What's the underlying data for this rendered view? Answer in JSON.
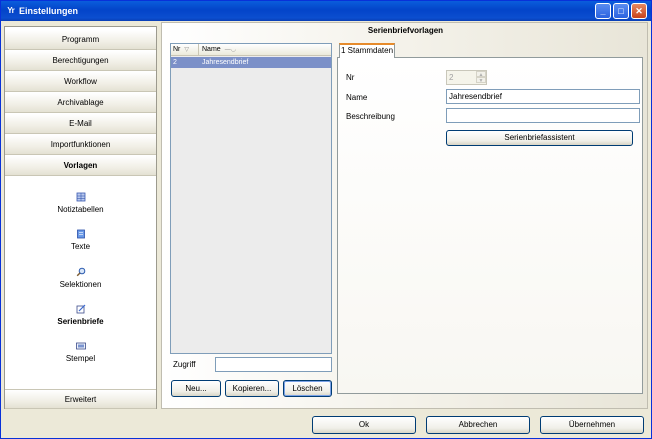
{
  "window": {
    "title": "Einstellungen",
    "icon": "app-logo-icon",
    "controls": {
      "minimize": "_",
      "maximize": "□",
      "close": "✕"
    }
  },
  "sidebar": {
    "items": [
      {
        "label": "Programm"
      },
      {
        "label": "Berechtigungen"
      },
      {
        "label": "Workflow"
      },
      {
        "label": "Archivablage"
      },
      {
        "label": "E-Mail"
      },
      {
        "label": "Importfunktionen"
      },
      {
        "label": "Vorlagen",
        "active": true
      }
    ],
    "sub_items": [
      {
        "label": "Notiztabellen",
        "icon": "table-icon"
      },
      {
        "label": "Texte",
        "icon": "text-icon"
      },
      {
        "label": "Selektionen",
        "icon": "magnifier-icon"
      },
      {
        "label": "Serienbriefe",
        "icon": "letter-icon",
        "active": true
      },
      {
        "label": "Stempel",
        "icon": "stamp-icon"
      }
    ],
    "footer": {
      "label": "Erweitert"
    }
  },
  "panel": {
    "title": "Serienbriefvorlagen",
    "list": {
      "columns": [
        "Nr",
        "Name"
      ],
      "rows": [
        {
          "nr": "2",
          "name": "Jahresendbrief"
        }
      ]
    },
    "zugriff": {
      "label": "Zugriff",
      "value": ""
    },
    "buttons": {
      "new": "Neu...",
      "copy": "Kopieren...",
      "delete": "Löschen"
    },
    "tab": {
      "label": "1 Stammdaten",
      "fields": {
        "nr": {
          "label": "Nr",
          "value": "2"
        },
        "name": {
          "label": "Name",
          "value": "Jahresendbrief"
        },
        "description": {
          "label": "Beschreibung",
          "value": ""
        }
      },
      "assistant_button": "Serienbriefassistent"
    }
  },
  "footer": {
    "ok": "Ok",
    "cancel": "Abbrechen",
    "apply": "Übernehmen"
  }
}
